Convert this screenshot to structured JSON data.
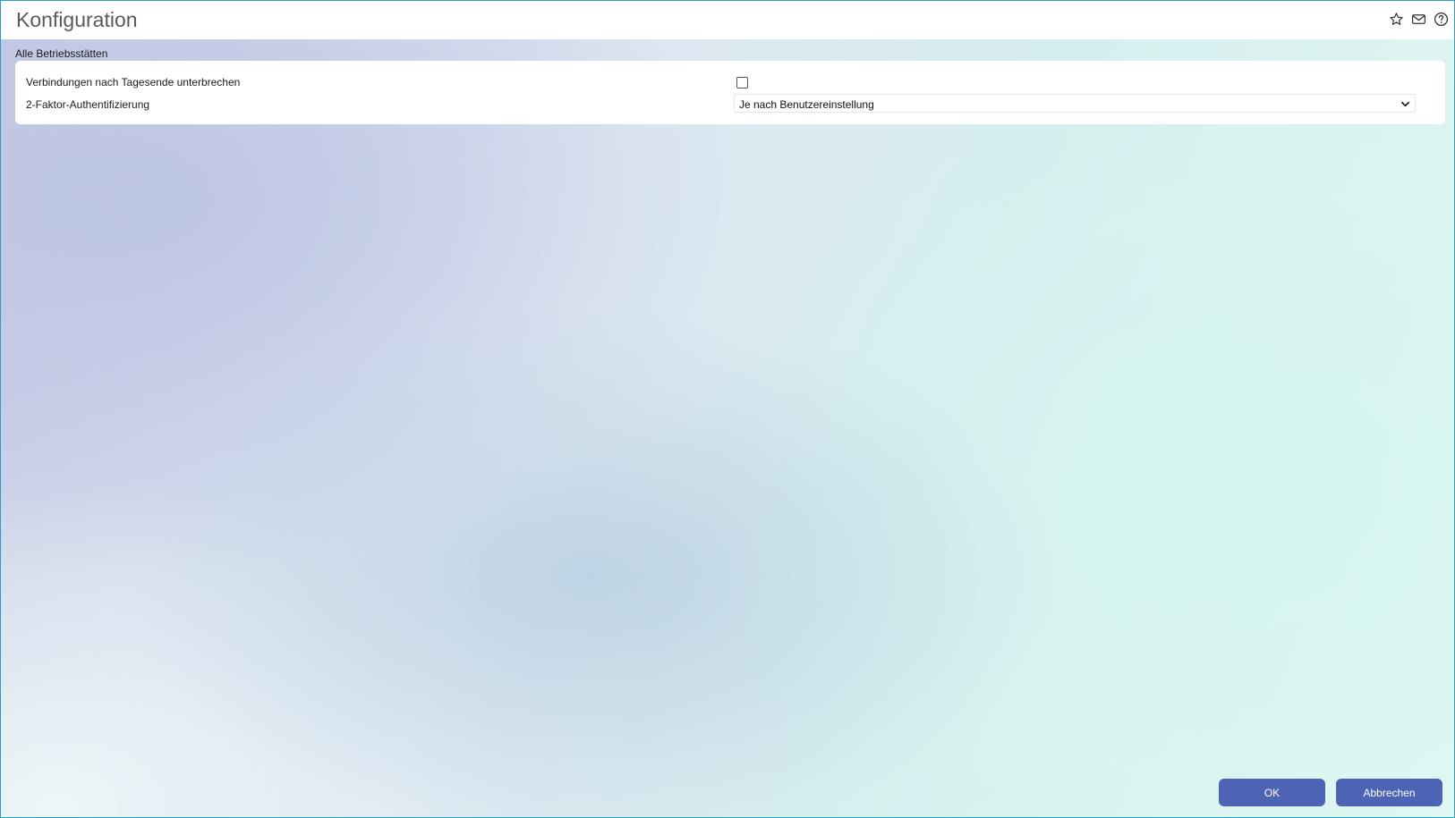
{
  "window": {
    "title": "Konfiguration",
    "icons": [
      "star-icon",
      "mail-icon",
      "help-icon"
    ]
  },
  "section": {
    "title": "Alle Betriebsstätten"
  },
  "settings": [
    {
      "label": "Verbindungen nach Tagesende unterbrechen",
      "control": "checkbox",
      "checked": false
    },
    {
      "label": "2-Faktor-Authentifizierung",
      "control": "select",
      "value": "Je nach Benutzereinstellung"
    }
  ],
  "buttons": {
    "ok": "OK",
    "cancel": "Abbrechen"
  },
  "colors": {
    "border": "#2a9fc4",
    "button": "#4d63b3",
    "title_text": "#5a5a5a"
  }
}
